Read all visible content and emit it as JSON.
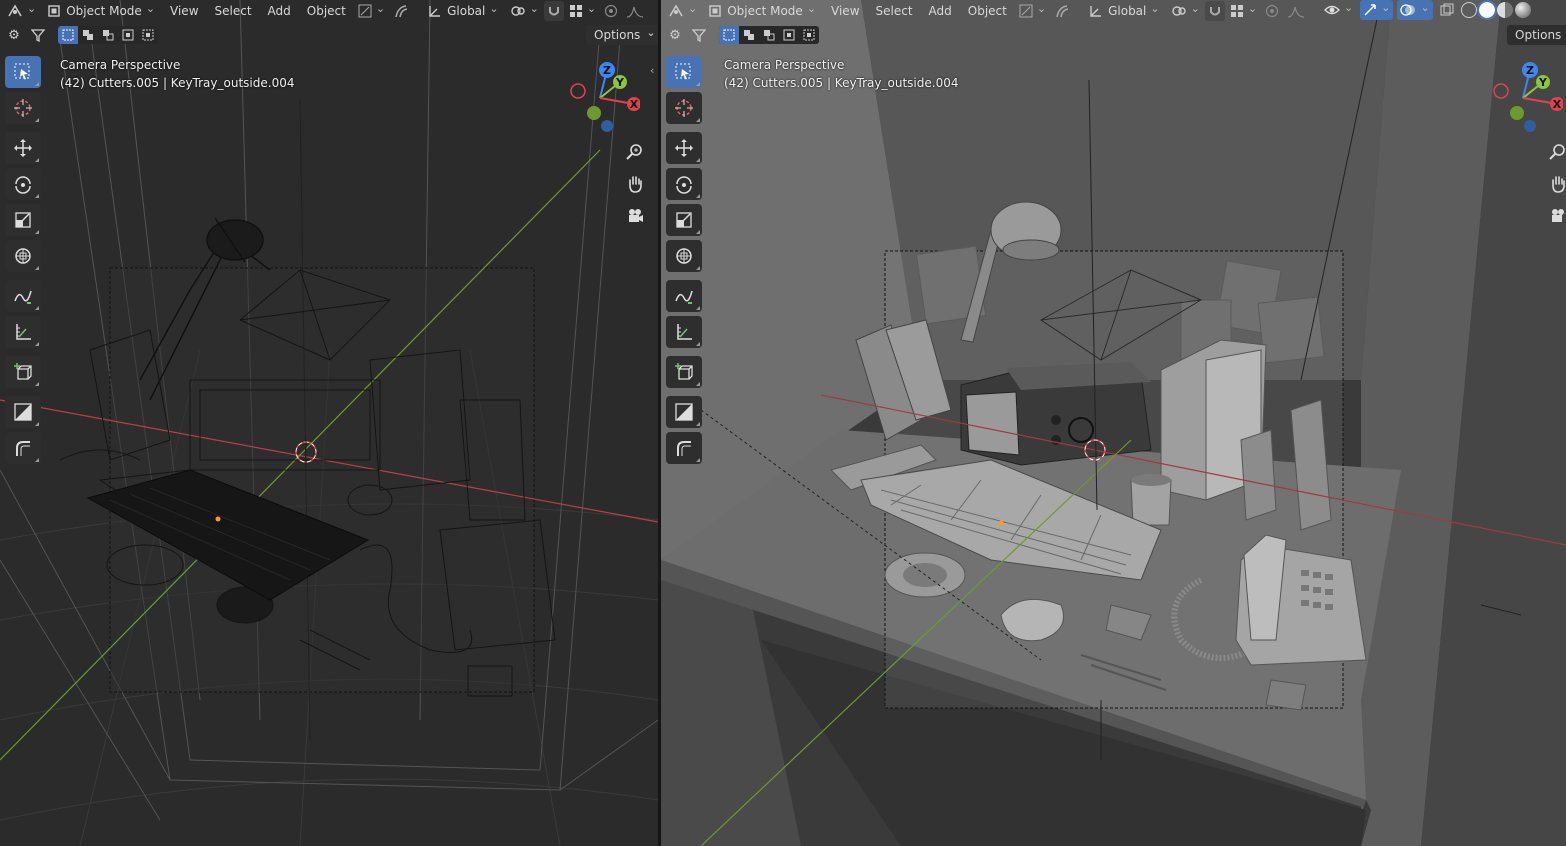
{
  "left_view": {
    "header": {
      "mode": "Object Mode",
      "menus": [
        "View",
        "Select",
        "Add",
        "Object"
      ],
      "orientation": "Global"
    },
    "options_label": "Options",
    "overlay": {
      "line1": "Camera Perspective",
      "line2": "(42) Cutters.005 | KeyTray_outside.004"
    },
    "shading": "wireframe"
  },
  "right_view": {
    "header": {
      "mode": "Object Mode",
      "menus": [
        "View",
        "Select",
        "Add",
        "Object"
      ],
      "orientation": "Global"
    },
    "options_label": "Options",
    "overlay": {
      "line1": "Camera Perspective",
      "line2": "(42) Cutters.005 | KeyTray_outside.004"
    },
    "shading": "solid"
  },
  "gizmo_axes": {
    "x": "X",
    "y": "Y",
    "z": "Z"
  },
  "tools": [
    "select-box-icon",
    "cursor-icon",
    "move-icon",
    "rotate-icon",
    "scale-icon",
    "transform-icon",
    "annotate-icon",
    "measure-icon",
    "add-cube-icon",
    "shear-icon",
    "bend-icon"
  ],
  "colors": {
    "accent": "#4772b3",
    "x_axis": "#e0424f",
    "y_axis": "#8cc63f",
    "z_axis": "#3d88f0",
    "wire_bg": "#2b2b2b",
    "solid_bg": "#3d3d3d"
  }
}
